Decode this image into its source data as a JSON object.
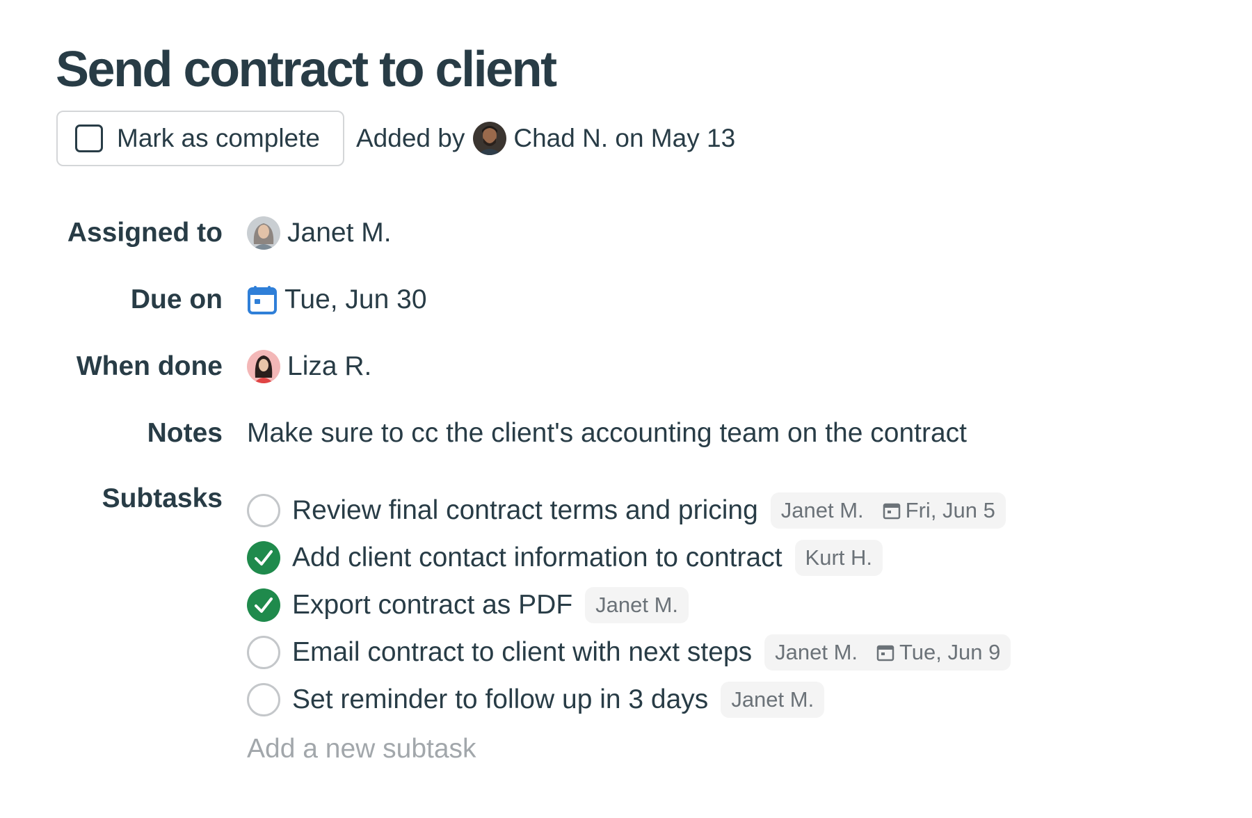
{
  "task": {
    "title": "Send contract to client",
    "complete_button_label": "Mark as complete",
    "added_by_prefix": "Added by",
    "added_by_suffix": "Chad N. on May 13"
  },
  "fields": {
    "assigned": {
      "label": "Assigned to",
      "value": "Janet M."
    },
    "due": {
      "label": "Due on",
      "value": "Tue, Jun 30"
    },
    "when_done": {
      "label": "When done",
      "value": "Liza R."
    },
    "notes": {
      "label": "Notes",
      "value": "Make sure to cc the client's accounting team on the contract"
    },
    "subtasks_label": "Subtasks"
  },
  "subtasks": [
    {
      "text": "Review final contract terms and pricing",
      "done": false,
      "assignee": "Janet M.",
      "due": "Fri, Jun 5"
    },
    {
      "text": "Add client contact information to contract",
      "done": true,
      "assignee": "Kurt H.",
      "due": ""
    },
    {
      "text": "Export contract as PDF",
      "done": true,
      "assignee": "Janet M.",
      "due": ""
    },
    {
      "text": "Email contract to client with next steps",
      "done": false,
      "assignee": "Janet M.",
      "due": "Tue, Jun 9"
    },
    {
      "text": "Set reminder to follow up in 3 days",
      "done": false,
      "assignee": "Janet M.",
      "due": ""
    }
  ],
  "add_subtask_placeholder": "Add a new subtask",
  "colors": {
    "text": "#283c46",
    "check_green": "#1f8a4c",
    "calendar_blue": "#2f7fd8",
    "muted": "#a2a7ab"
  },
  "icons": {
    "calendar": "calendar-icon",
    "check": "check-icon"
  }
}
